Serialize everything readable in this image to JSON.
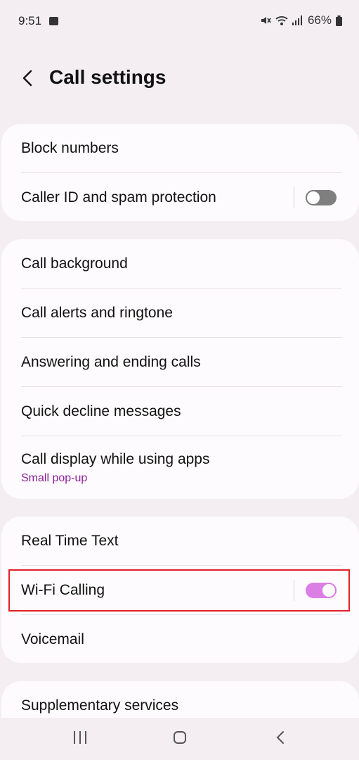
{
  "status_bar": {
    "time": "9:51",
    "battery": "66%"
  },
  "header": {
    "title": "Call settings"
  },
  "groups": [
    {
      "items": [
        {
          "label": "Block numbers"
        },
        {
          "label": "Caller ID and spam protection",
          "toggle": "off"
        }
      ]
    },
    {
      "items": [
        {
          "label": "Call background"
        },
        {
          "label": "Call alerts and ringtone"
        },
        {
          "label": "Answering and ending calls"
        },
        {
          "label": "Quick decline messages"
        },
        {
          "label": "Call display while using apps",
          "sublabel": "Small pop-up"
        }
      ]
    },
    {
      "items": [
        {
          "label": "Real Time Text"
        },
        {
          "label": "Wi-Fi Calling",
          "toggle": "on"
        },
        {
          "label": "Voicemail"
        }
      ]
    },
    {
      "items": [
        {
          "label": "Supplementary services"
        }
      ]
    }
  ],
  "colors": {
    "accent": "#db7fe4",
    "sublabel": "#8b1f9a",
    "highlight": "#e0202a"
  }
}
